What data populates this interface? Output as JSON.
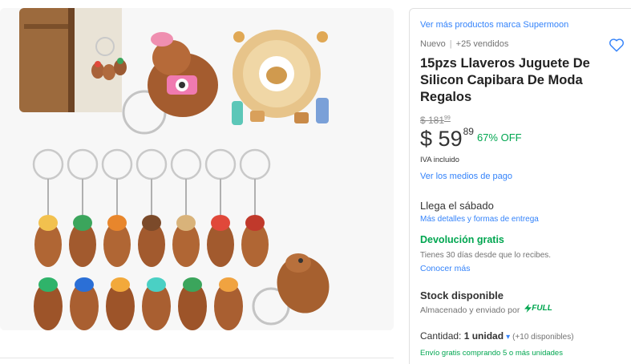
{
  "product": {
    "brand_link": "Ver más productos marca Supermoon",
    "condition": "Nuevo",
    "sold": "+25 vendidos",
    "title": "15pzs Llaveros Juguete De Silicon Capibara De Moda Regalos",
    "old_price": "$ 181",
    "old_price_cents": "99",
    "price_currency": "$",
    "price_whole": "59",
    "price_cents": "89",
    "discount": "67% OFF",
    "tax_note": "IVA incluido",
    "payment_link": "Ver los medios de pago"
  },
  "delivery": {
    "arrives": "Llega el sábado",
    "details_link": "Más detalles y formas de entrega"
  },
  "returns": {
    "title": "Devolución gratis",
    "description": "Tienes 30 días desde que lo recibes.",
    "link": "Conocer más"
  },
  "stock": {
    "title": "Stock disponible",
    "description": "Almacenado y enviado por",
    "badge": "FULL"
  },
  "quantity": {
    "label": "Cantidad:",
    "value": "1 unidad",
    "available": "(+10 disponibles)"
  },
  "shipping_promo": "Envío gratis comprando 5 o más unidades",
  "icons": {
    "favorite": "heart-icon",
    "dropdown": "chevron-down-icon",
    "full": "lightning-icon"
  },
  "colors": {
    "link": "#3483fa",
    "success": "#00a650",
    "text": "#333333",
    "muted": "#737373"
  }
}
